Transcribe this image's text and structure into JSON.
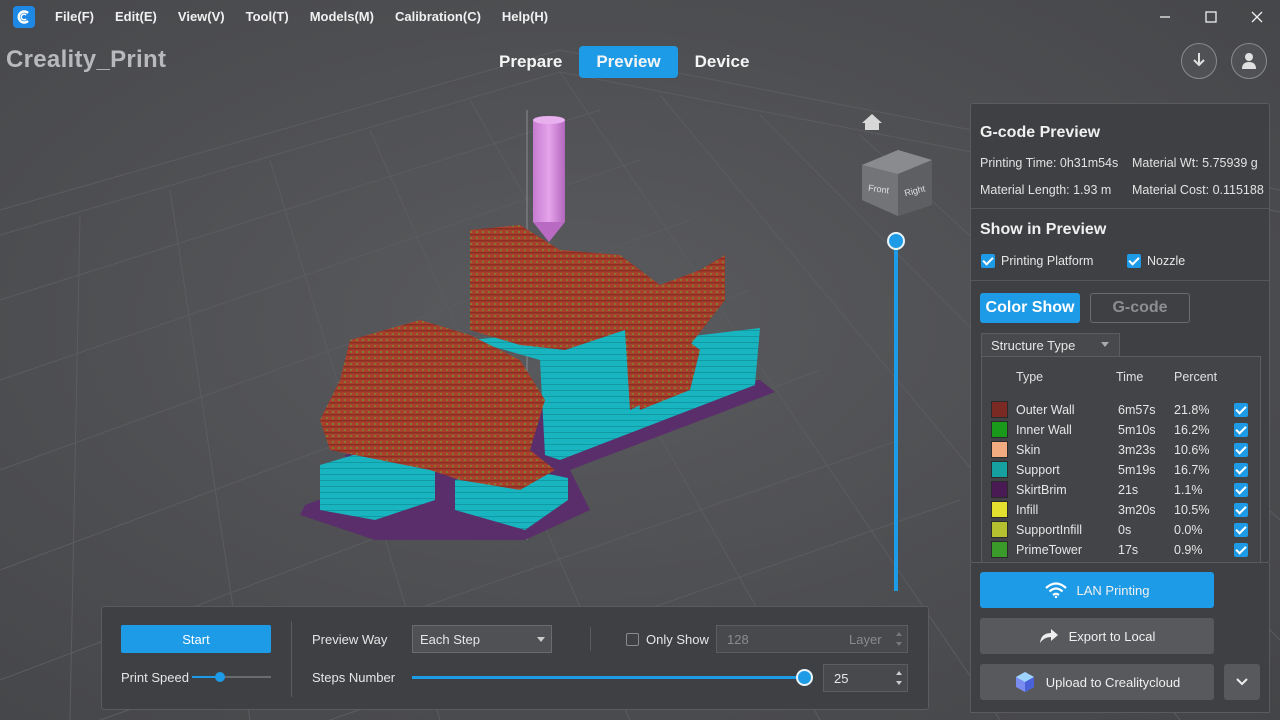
{
  "menu": [
    "File(F)",
    "Edit(E)",
    "View(V)",
    "Tool(T)",
    "Models(M)",
    "Calibration(C)",
    "Help(H)"
  ],
  "app_title": "Creality_Print",
  "mode_tabs": [
    "Prepare",
    "Preview",
    "Device"
  ],
  "active_tab": "Preview",
  "view_cube": {
    "front": "Front",
    "right": "Right"
  },
  "gcode_preview": {
    "title": "G-code Preview",
    "printing_time": "Printing Time: 0h31m54s",
    "material_wt": "Material Wt: 5.75939 g",
    "material_length": "Material Length: 1.93 m",
    "material_cost": "Material Cost: 0.115188"
  },
  "show_in_preview": {
    "title": "Show in Preview",
    "printing_platform": "Printing Platform",
    "nozzle": "Nozzle"
  },
  "color_show_label": "Color Show",
  "gcode_label": "G-code",
  "structure_type_label": "Structure Type",
  "table_headers": [
    "Type",
    "Time",
    "Percent"
  ],
  "structure_rows": [
    {
      "type": "Outer Wall",
      "time": "6m57s",
      "percent": "21.8%",
      "color": "#7a2a22"
    },
    {
      "type": "Inner Wall",
      "time": "5m10s",
      "percent": "16.2%",
      "color": "#1a9a1a"
    },
    {
      "type": "Skin",
      "time": "3m23s",
      "percent": "10.6%",
      "color": "#f2aa80"
    },
    {
      "type": "Support",
      "time": "5m19s",
      "percent": "16.7%",
      "color": "#16a0a0"
    },
    {
      "type": "SkirtBrim",
      "time": "21s",
      "percent": "1.1%",
      "color": "#4a1a55"
    },
    {
      "type": "Infill",
      "time": "3m20s",
      "percent": "10.5%",
      "color": "#e4e030"
    },
    {
      "type": "SupportInfill",
      "time": "0s",
      "percent": "0.0%",
      "color": "#b4c030"
    },
    {
      "type": "PrimeTower",
      "time": "17s",
      "percent": "0.9%",
      "color": "#3a9a2a"
    }
  ],
  "actions": {
    "lan_printing": "LAN Printing",
    "export_local": "Export to Local",
    "upload_cloud": "Upload to Crealitycloud"
  },
  "bottom": {
    "start": "Start",
    "print_speed": "Print Speed",
    "print_speed_level": 0.35,
    "preview_way_label": "Preview Way",
    "preview_way_value": "Each Step",
    "only_show": "Only Show",
    "layer_value": "128",
    "layer_label": "Layer",
    "steps_number": "Steps Number",
    "steps_value": "25",
    "steps_level": 1.0
  },
  "colors": {
    "accent": "#1e9be6"
  }
}
